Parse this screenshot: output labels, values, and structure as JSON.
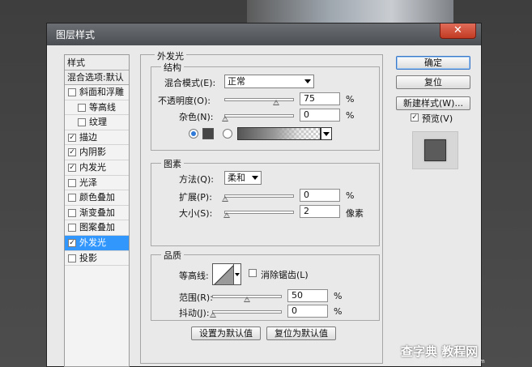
{
  "window": {
    "title": "图层样式",
    "close_symbol": "✕"
  },
  "styles_panel": {
    "header": "样式",
    "blending_options": "混合选项:默认",
    "items": [
      {
        "label": "斜面和浮雕",
        "checked": false,
        "sub": false,
        "active": false
      },
      {
        "label": "等高线",
        "checked": false,
        "sub": true,
        "active": false
      },
      {
        "label": "纹理",
        "checked": false,
        "sub": true,
        "active": false
      },
      {
        "label": "描边",
        "checked": true,
        "sub": false,
        "active": false
      },
      {
        "label": "内阴影",
        "checked": true,
        "sub": false,
        "active": false
      },
      {
        "label": "内发光",
        "checked": true,
        "sub": false,
        "active": false
      },
      {
        "label": "光泽",
        "checked": false,
        "sub": false,
        "active": false
      },
      {
        "label": "颜色叠加",
        "checked": false,
        "sub": false,
        "active": false
      },
      {
        "label": "渐变叠加",
        "checked": false,
        "sub": false,
        "active": false
      },
      {
        "label": "图案叠加",
        "checked": false,
        "sub": false,
        "active": false
      },
      {
        "label": "外发光",
        "checked": true,
        "sub": false,
        "active": true
      },
      {
        "label": "投影",
        "checked": false,
        "sub": false,
        "active": false
      }
    ]
  },
  "outer_glow": {
    "title": "外发光",
    "structure": {
      "title": "结构",
      "blend_mode_label": "混合模式(E):",
      "blend_mode_value": "正常",
      "opacity_label": "不透明度(O):",
      "opacity_value": "75",
      "opacity_unit": "%",
      "opacity_fraction": 0.75,
      "noise_label": "杂色(N):",
      "noise_value": "0",
      "noise_unit": "%",
      "noise_fraction": 0,
      "color_mode_selected": "solid",
      "swatch_color": "#464646"
    },
    "elements": {
      "title": "图素",
      "technique_label": "方法(Q):",
      "technique_value": "柔和",
      "spread_label": "扩展(P):",
      "spread_value": "0",
      "spread_unit": "%",
      "spread_fraction": 0,
      "size_label": "大小(S):",
      "size_value": "2",
      "size_unit": "像素",
      "size_fraction": 0.02
    },
    "quality": {
      "title": "品质",
      "contour_label": "等高线:",
      "antialias_label": "消除锯齿(L)",
      "antialias_checked": false,
      "range_label": "范围(R):",
      "range_value": "50",
      "range_unit": "%",
      "range_fraction": 0.5,
      "jitter_label": "抖动(J):",
      "jitter_value": "0",
      "jitter_unit": "%",
      "jitter_fraction": 0
    },
    "make_default": "设置为默认值",
    "reset_default": "复位为默认值"
  },
  "side_buttons": {
    "ok": "确定",
    "reset": "复位",
    "new_style": "新建样式(W)...",
    "preview_label": "预览(V)",
    "preview_checked": true
  },
  "icons": {
    "check": "✓"
  },
  "colors": {
    "accent": "#3297fd",
    "preview_fill": "#5b5b5b"
  },
  "watermark": {
    "main": "查字典 教程网",
    "sub": "jiaocheng.chazidian.com"
  }
}
